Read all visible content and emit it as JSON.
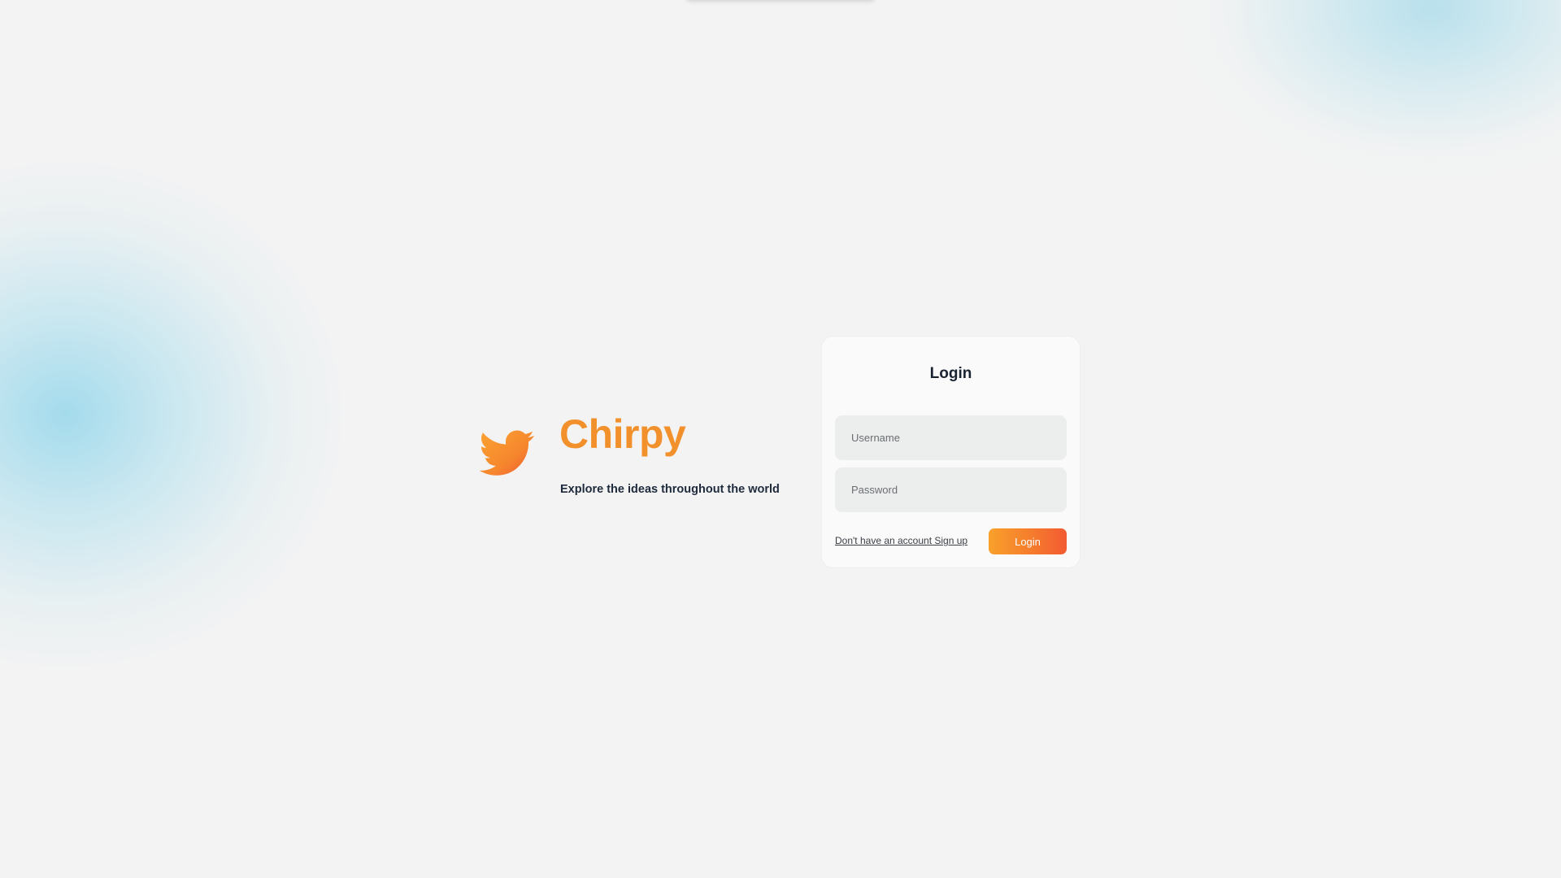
{
  "brand": {
    "name": "Chirpy",
    "tagline": "Explore the ideas throughout the world",
    "logo_icon": "bird-icon",
    "color": "#f2912c"
  },
  "login_card": {
    "title": "Login",
    "username": {
      "value": "",
      "placeholder": "Username"
    },
    "password": {
      "value": "",
      "placeholder": "Password"
    },
    "signup_link": "Don't have an account Sign up",
    "login_button": "Login"
  },
  "colors": {
    "background": "#f3f3f3",
    "accent_start": "#f9a02b",
    "accent_end": "#f25b33",
    "blob": "#96d7eb",
    "text_dark": "#1a2332"
  }
}
